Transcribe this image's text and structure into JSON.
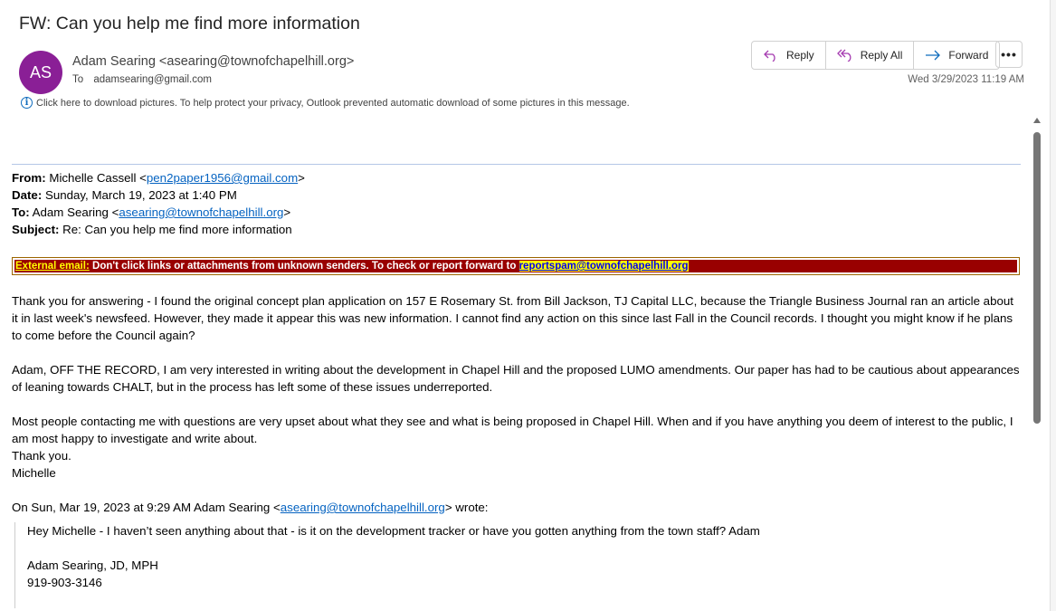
{
  "email": {
    "subject": "FW: Can you help me find more information",
    "avatar_initials": "AS",
    "avatar_color": "#8a1f96",
    "sender": "Adam Searing <asearing@townofchapelhill.org>",
    "to_label": "To",
    "to_address": "adamsearing@gmail.com",
    "timestamp": "Wed 3/29/2023 11:19 AM",
    "info_bar": "Click here to download pictures. To help protect your privacy, Outlook prevented automatic download of some pictures in this message."
  },
  "actions": {
    "reply": "Reply",
    "reply_all": "Reply All",
    "forward": "Forward",
    "more": "•••"
  },
  "forwarded": {
    "from_label": "From:",
    "from_name": " Michelle Cassell <",
    "from_email": "pen2paper1956@gmail.com",
    "from_close": ">",
    "date_label": "Date:",
    "date_value": " Sunday, March 19, 2023 at 1:40 PM",
    "to_label": "To:",
    "to_name": " Adam Searing <",
    "to_email": "asearing@townofchapelhill.org",
    "to_close": ">",
    "subject_label": "Subject:",
    "subject_value": " Re: Can you help me find more information"
  },
  "warning": {
    "label": "External email:",
    "text": " Don't click links or attachments from unknown senders. To check or report forward to ",
    "link": "reportspam@townofchapelhill.org",
    "bg_color": "#990000"
  },
  "body": {
    "p1": "Thank you for answering - I found the original concept plan application on 157 E Rosemary St. from Bill Jackson, TJ Capital LLC, because the Triangle Business Journal ran an article about it in last week's newsfeed. However, they made it appear this was new information. I cannot find any action on this since last Fall in the Council records. I thought you might know if he plans to come before the Council again?",
    "p2": "Adam, OFF THE RECORD, I am very interested in writing about the development in Chapel Hill and the proposed LUMO amendments. Our paper has had to be cautious about appearances of leaning towards CHALT, but in the process has left some of these issues underreported.",
    "p3": "Most people contacting me with questions are very upset about what they see and what is being proposed in Chapel Hill. When and if you have anything you deem of interest to the public, I am most happy to investigate and write about.",
    "closing": "Thank you.",
    "signature": "Michelle"
  },
  "quote": {
    "intro_before": "On Sun, Mar 19, 2023 at 9:29 AM Adam Searing <",
    "intro_email": "asearing@townofchapelhill.org",
    "intro_after": "> wrote:",
    "line1": "Hey Michelle - I haven’t seen anything about that - is it on the development tracker or have you gotten anything from the town staff?  Adam",
    "sig_name": "Adam Searing, JD, MPH",
    "sig_phone": "919-903-3146"
  }
}
